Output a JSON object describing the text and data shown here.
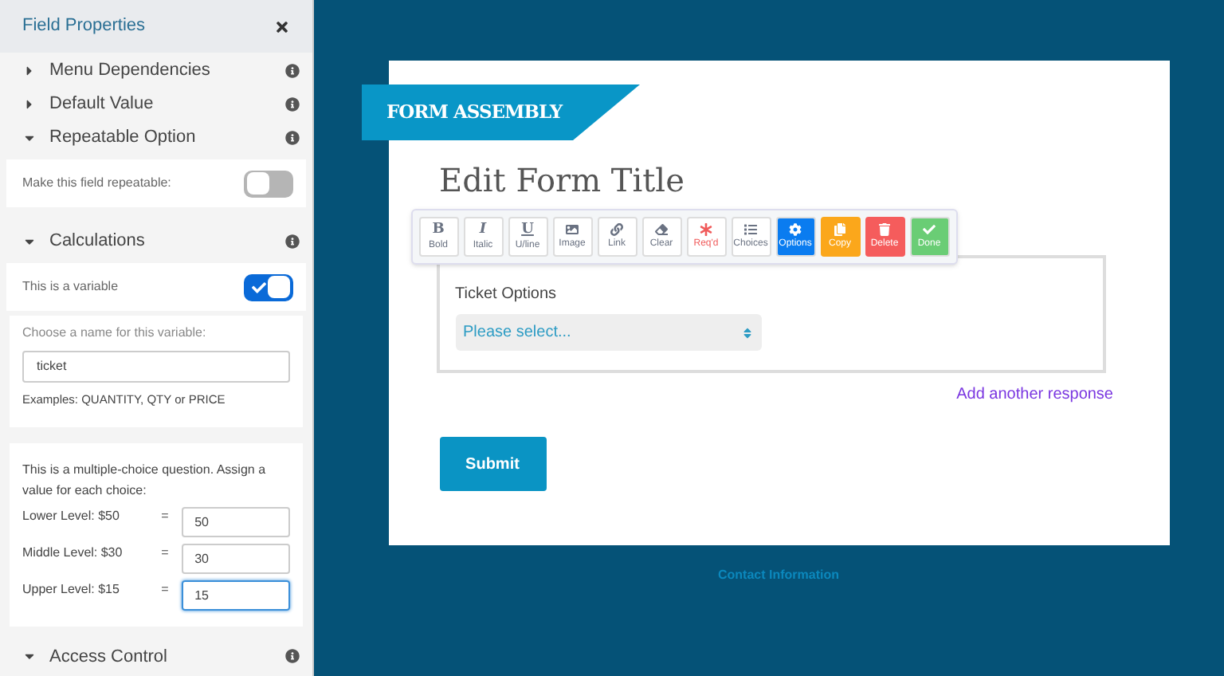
{
  "sidebar": {
    "title": "Field Properties",
    "items": [
      {
        "kind": "section",
        "label": "Menu Dependencies",
        "expanded": false
      },
      {
        "kind": "section",
        "label": "Default Value",
        "expanded": false
      },
      {
        "kind": "section",
        "label": "Repeatable Option",
        "expanded": true
      },
      {
        "kind": "toggle",
        "label": "Make this field repeatable:",
        "on": false
      },
      {
        "kind": "section",
        "label": "Calculations",
        "expanded": true
      },
      {
        "kind": "toggle",
        "label": "This is a variable",
        "on": true
      },
      {
        "kind": "variable",
        "label": "Choose a name for this variable:",
        "value": "ticket",
        "hint": "Examples: QUANTITY, QTY or PRICE"
      },
      {
        "kind": "choices",
        "intro": "This is a multiple-choice question. Assign a value for each choice:",
        "rows": [
          {
            "label": "Lower Level: $50",
            "sign": "=",
            "value": "50",
            "focused": false
          },
          {
            "label": "Middle Level: $30",
            "sign": "=",
            "value": "30",
            "focused": false
          },
          {
            "label": "Upper Level: $15",
            "sign": "=",
            "value": "15",
            "focused": true
          }
        ]
      },
      {
        "kind": "section",
        "label": "Access Control",
        "expanded": true
      }
    ]
  },
  "form": {
    "logo": "FORM ASSEMBLY",
    "title": "Edit Form Title",
    "toolbar": [
      {
        "kind": "bold",
        "glyph": "B",
        "label": "Bold"
      },
      {
        "kind": "italic",
        "glyph": "I",
        "label": "Italic"
      },
      {
        "kind": "underline",
        "glyph": "U",
        "label": "U/line"
      },
      {
        "kind": "image",
        "label": "Image"
      },
      {
        "kind": "link",
        "label": "Link"
      },
      {
        "kind": "clear",
        "label": "Clear"
      },
      {
        "kind": "required",
        "label": "Req'd"
      },
      {
        "kind": "choices",
        "label": "Choices"
      },
      {
        "kind": "options",
        "label": "Options"
      },
      {
        "kind": "copy",
        "label": "Copy"
      },
      {
        "kind": "delete",
        "label": "Delete"
      },
      {
        "kind": "done",
        "label": "Done"
      }
    ],
    "field_label": "Ticket Options",
    "select_placeholder": "Please select...",
    "add_link": "Add another response",
    "submit": "Submit"
  },
  "footer": {
    "link": "Contact Information"
  }
}
